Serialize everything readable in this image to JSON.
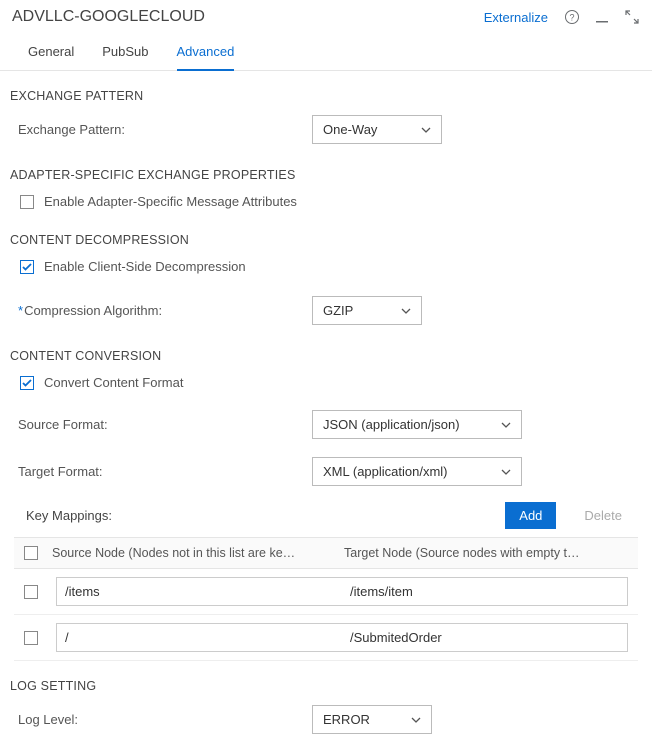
{
  "header": {
    "title": "ADVLLC-GOOGLECLOUD",
    "externalize": "Externalize"
  },
  "tabs": {
    "general": "General",
    "pubsub": "PubSub",
    "advanced": "Advanced"
  },
  "sections": {
    "exchange_pattern": "EXCHANGE PATTERN",
    "adapter_props": "ADAPTER-SPECIFIC EXCHANGE PROPERTIES",
    "content_decomp": "CONTENT DECOMPRESSION",
    "content_conv": "CONTENT CONVERSION",
    "log_setting": "LOG SETTING"
  },
  "fields": {
    "exchange_pattern_label": "Exchange Pattern:",
    "exchange_pattern_value": "One-Way",
    "enable_adapter_attr": "Enable Adapter-Specific Message Attributes",
    "enable_client_decomp": "Enable Client-Side Decompression",
    "compression_algo_label": "Compression Algorithm:",
    "compression_algo_value": "GZIP",
    "convert_content": "Convert Content Format",
    "source_format_label": "Source Format:",
    "source_format_value": "JSON (application/json)",
    "target_format_label": "Target Format:",
    "target_format_value": "XML (application/xml)",
    "key_mappings_label": "Key Mappings:",
    "add": "Add",
    "delete": "Delete",
    "table_src_header": "Source Node (Nodes not in this list are ke…",
    "table_tgt_header": "Target Node (Source nodes with empty t…",
    "log_level_label": "Log Level:",
    "log_level_value": "ERROR"
  },
  "rows": [
    {
      "src": "/items",
      "tgt": "/items/item"
    },
    {
      "src": "/",
      "tgt": "/SubmitedOrder"
    }
  ]
}
